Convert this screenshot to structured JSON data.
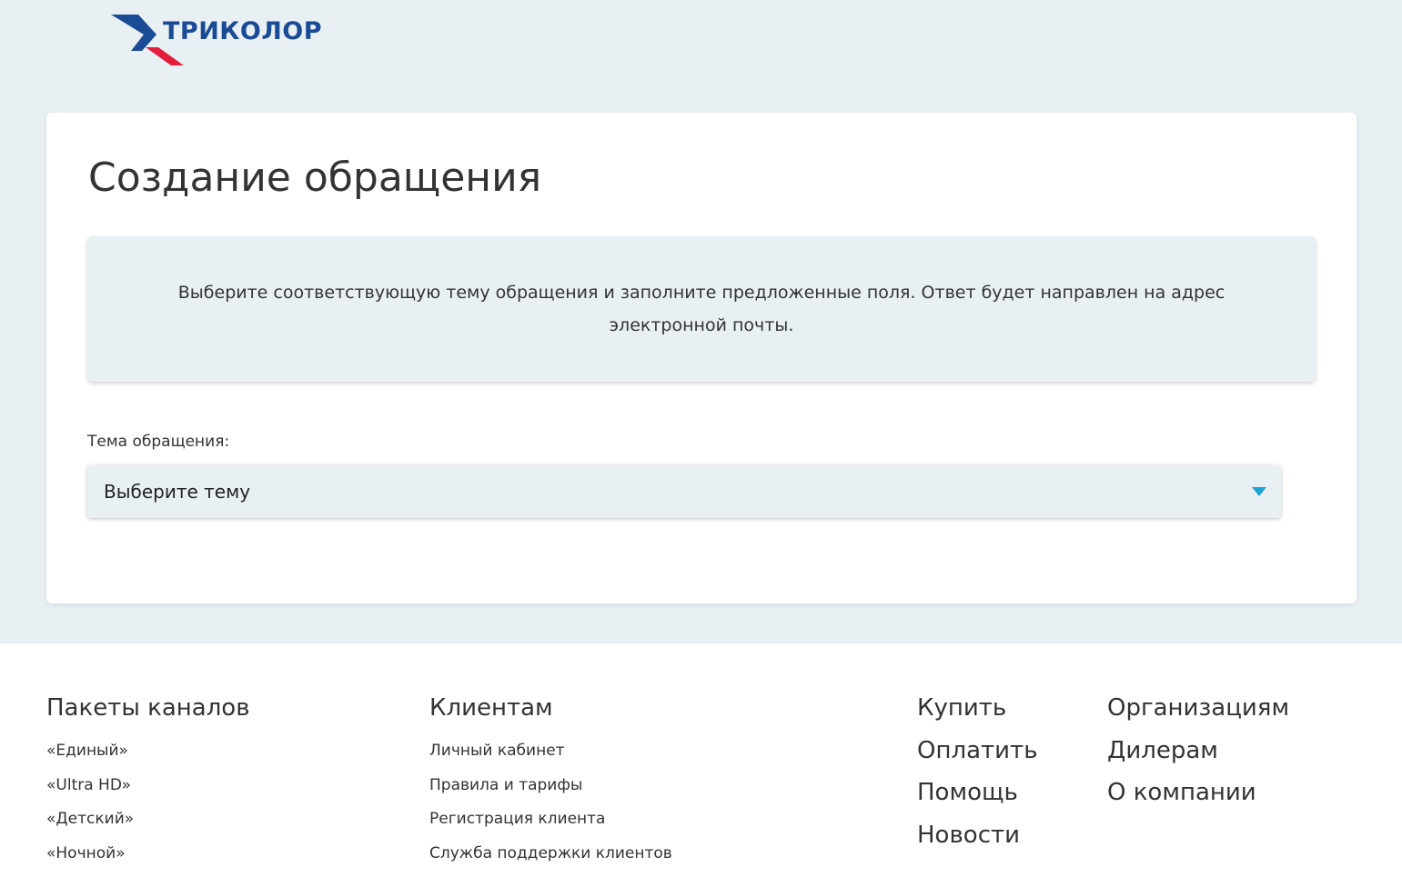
{
  "header": {
    "logo_text": "ТРИКОЛОР",
    "logo_colors": {
      "blue": "#1a4b96",
      "red": "#e31e3c"
    }
  },
  "main": {
    "title": "Создание обращения",
    "notice": "Выберите соответствующую тему обращения и заполните предложенные поля. Ответ будет направлен на адрес электронной почты.",
    "topic_label": "Тема обращения:",
    "topic_select": {
      "selected": "Выберите тему",
      "arrow_icon": "caret-down-icon",
      "arrow_color": "#1ba6d8"
    }
  },
  "footer": {
    "packages": {
      "title": "Пакеты каналов",
      "items": [
        "«Единый»",
        "«Ultra HD»",
        "«Детский»",
        "«Ночной»"
      ]
    },
    "clients": {
      "title": "Клиентам",
      "items": [
        "Личный кабинет",
        "Правила и тарифы",
        "Регистрация клиента",
        "Служба поддержки клиентов"
      ]
    },
    "main_links": [
      "Купить",
      "Оплатить",
      "Помощь",
      "Новости"
    ],
    "org_links": [
      "Организациям",
      "Дилерам",
      "О компании"
    ]
  }
}
